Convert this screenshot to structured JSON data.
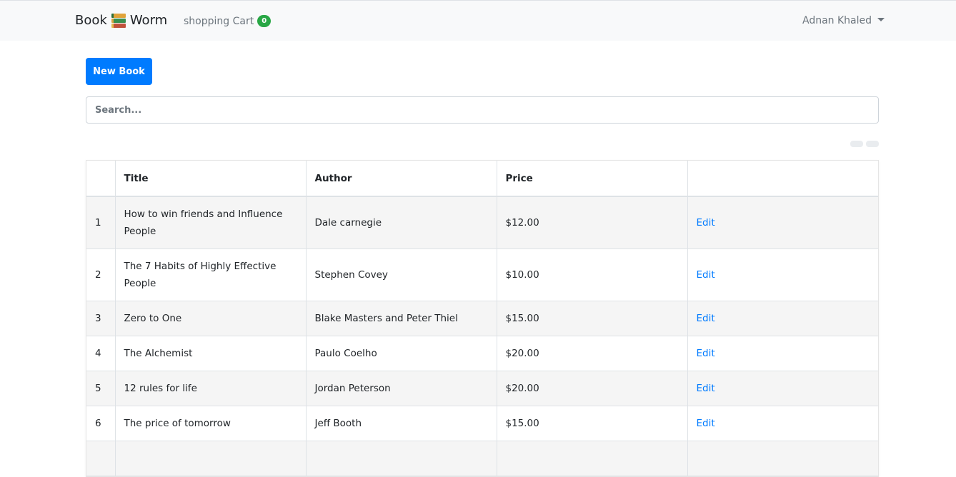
{
  "navbar": {
    "brand_left": "Book",
    "brand_icon": "books-icon",
    "brand_right": "Worm",
    "cart_label": "shopping Cart",
    "cart_count": "0",
    "user_name": "Adnan Khaled"
  },
  "toolbar": {
    "new_book_label": "New Book"
  },
  "search": {
    "placeholder": "Search...",
    "value": ""
  },
  "table": {
    "headers": [
      "",
      "Title",
      "Author",
      "Price",
      ""
    ],
    "rows": [
      {
        "index": "1",
        "title": "How to win friends and Influence People",
        "author": "Dale carnegie",
        "price": "$12.00",
        "action": "Edit"
      },
      {
        "index": "2",
        "title": "The 7 Habits of Highly Effective People",
        "author": "Stephen Covey",
        "price": "$10.00",
        "action": "Edit"
      },
      {
        "index": "3",
        "title": "Zero to One",
        "author": "Blake Masters and Peter Thiel",
        "price": "$15.00",
        "action": "Edit"
      },
      {
        "index": "4",
        "title": "The Alchemist",
        "author": "Paulo Coelho",
        "price": "$20.00",
        "action": "Edit"
      },
      {
        "index": "5",
        "title": "12 rules for life",
        "author": "Jordan Peterson",
        "price": "$20.00",
        "action": "Edit"
      },
      {
        "index": "6",
        "title": "The price of tomorrow",
        "author": "Jeff Booth",
        "price": "$15.00",
        "action": "Edit"
      }
    ]
  },
  "colors": {
    "primary": "#007bff",
    "badge": "#28a745",
    "navbar_bg": "#f8f9fa"
  }
}
